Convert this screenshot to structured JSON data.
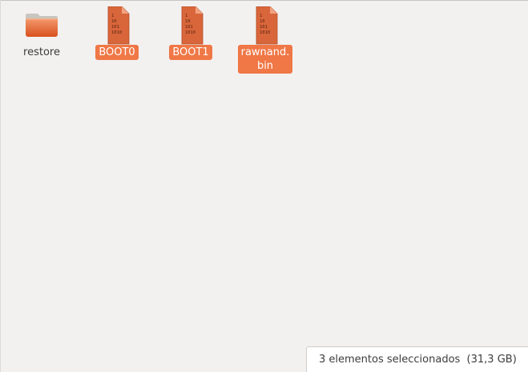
{
  "files": [
    {
      "name": "restore",
      "type": "folder",
      "selected": false
    },
    {
      "name": "BOOT0",
      "type": "binary",
      "selected": true
    },
    {
      "name": "BOOT1",
      "type": "binary",
      "selected": true
    },
    {
      "name_lines": [
        "rawnand.",
        "bin"
      ],
      "type": "binary",
      "selected": true
    }
  ],
  "icon_binary_text": [
    "1",
    "10",
    "101",
    "1010"
  ],
  "status": {
    "text": "3 elementos seleccionados  (31,3 GB)"
  },
  "colors": {
    "accent": "#f07746",
    "file_icon": "#d9663b",
    "folder": "#e8632e",
    "background": "#f2f1f0"
  }
}
